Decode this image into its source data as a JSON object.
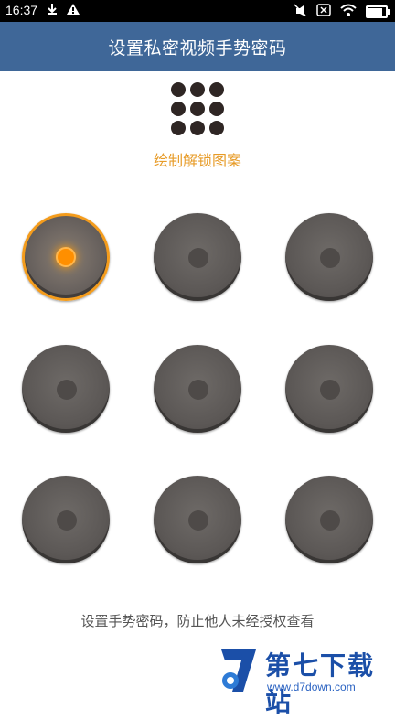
{
  "status_bar": {
    "time": "16:37"
  },
  "header": {
    "title": "设置私密视频手势密码"
  },
  "instruction": "绘制解锁图案",
  "pattern": {
    "nodes": [
      1,
      2,
      3,
      4,
      5,
      6,
      7,
      8,
      9
    ],
    "active": [
      1
    ]
  },
  "hint": "设置手势密码，防止他人未经授权查看",
  "watermark": {
    "title": "第七下载站",
    "url": "www.d7down.com"
  },
  "colors": {
    "header_bg": "#3f6798",
    "accent": "#f49c1c",
    "node": "#5c5856"
  }
}
